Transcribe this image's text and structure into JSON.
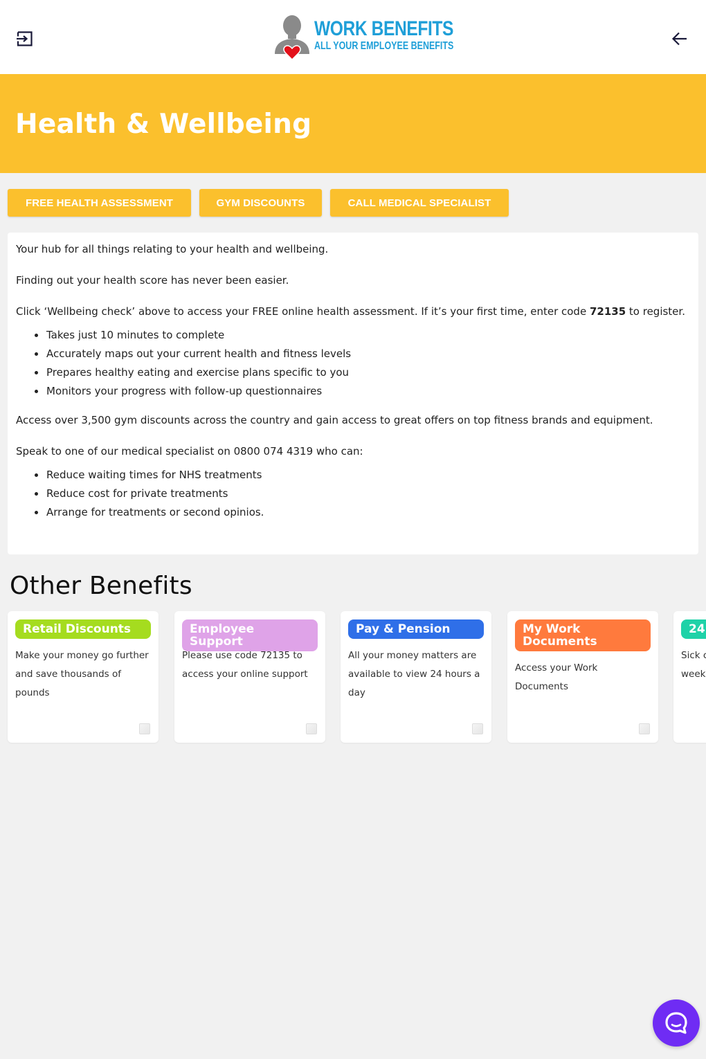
{
  "header": {
    "logo_title": "WORK BENEFITS",
    "logo_subtitle": "ALL YOUR EMPLOYEE BENEFITS",
    "logout_icon": "logout-icon",
    "back_icon": "arrow-left-icon"
  },
  "hero": {
    "title": "Health & Wellbeing",
    "color": "#fbc02d"
  },
  "tabs": [
    {
      "label": "FREE HEALTH ASSESSMENT"
    },
    {
      "label": "GYM DISCOUNTS"
    },
    {
      "label": "CALL MEDICAL SPECIALIST"
    }
  ],
  "content": {
    "intro": "Your hub for all things relating to your health and wellbeing.",
    "score": "Finding out your health score has never been easier.",
    "click_before": "Click ‘Wellbeing check’ above to access your FREE online health assessment. If it’s your first time, enter code ",
    "click_code": "72135",
    "click_after": " to register.",
    "assessment_points": [
      "Takes just 10 minutes to complete",
      "Accurately maps out your current health and fitness levels",
      "Prepares healthy eating and exercise plans specific to you",
      "Monitors your progress with follow-up questionnaires"
    ],
    "gym": "Access over 3,500 gym discounts across the country and gain access to great offers on top fitness brands and equipment.",
    "specialist": "Speak to one of our medical specialist on 0800 074 4319 who can:",
    "specialist_points": [
      "Reduce waiting times for NHS treatments",
      "Reduce cost for private treatments",
      "Arrange for treatments or second opinios."
    ]
  },
  "other_benefits": {
    "title": "Other Benefits",
    "cards": [
      {
        "title": "Retail Discounts",
        "description": "Make your money go further and save thousands of pounds",
        "color": "#a5dc1f"
      },
      {
        "title": "Employee Support",
        "description": "Please use code 72135 to access your online support",
        "color": "#dfa3e8"
      },
      {
        "title": "Pay & Pension",
        "description": "All your money matters are available to view 24 hours a day",
        "color": "#2f6fe8"
      },
      {
        "title": "My Work Documents",
        "description": "Access your Work Documents",
        "color": "#ff7a3d"
      },
      {
        "title": "24",
        "description": "Sick c week",
        "color": "#1fd2a8"
      }
    ]
  },
  "chat": {
    "icon": "chat-bubble-icon",
    "color": "#6f2cf4"
  }
}
